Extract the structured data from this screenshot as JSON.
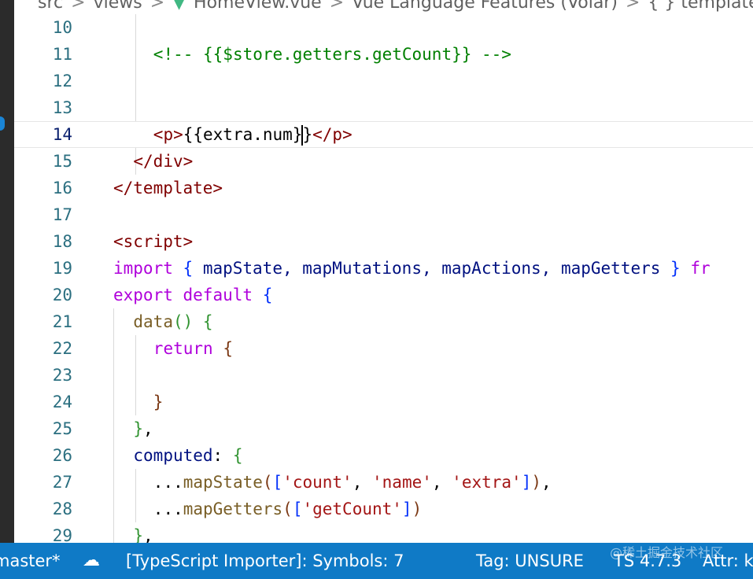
{
  "breadcrumb": {
    "items": [
      "src",
      "views",
      "HomeView.vue",
      "Vue Language Features (Volar)",
      "{ } template"
    ],
    "separator": ">",
    "vue_icon": "vue-logo-icon"
  },
  "editor": {
    "cursor_line": 14,
    "lines": [
      {
        "n": "10",
        "tokens": []
      },
      {
        "n": "11",
        "tokens": [
          {
            "t": "<!-- {{$store.getters.getCount}} -->",
            "c": "cmt"
          }
        ]
      },
      {
        "n": "12",
        "tokens": []
      },
      {
        "n": "13",
        "tokens": []
      },
      {
        "n": "14",
        "tokens": [
          {
            "t": "<p>",
            "c": "tag"
          },
          {
            "t": "{{extra.num}}",
            "c": ""
          },
          {
            "t": "</p>",
            "c": "tag"
          }
        ]
      },
      {
        "n": "15",
        "tokens": [
          {
            "t": "</div>",
            "c": "tag"
          }
        ]
      },
      {
        "n": "16",
        "tokens": [
          {
            "t": "</template>",
            "c": "tag"
          }
        ]
      },
      {
        "n": "17",
        "tokens": []
      },
      {
        "n": "18",
        "tokens": [
          {
            "t": "<script>",
            "c": "tag"
          }
        ]
      },
      {
        "n": "19",
        "tokens": [
          {
            "t": "import",
            "c": "kw"
          },
          {
            "t": " ",
            "c": ""
          },
          {
            "t": "{",
            "c": "br1"
          },
          {
            "t": " mapState, mapMutations, mapActions, mapGetters ",
            "c": "var"
          },
          {
            "t": "}",
            "c": "br1"
          },
          {
            "t": " fr",
            "c": "kw"
          }
        ]
      },
      {
        "n": "20",
        "tokens": [
          {
            "t": "export",
            "c": "kw"
          },
          {
            "t": " ",
            "c": ""
          },
          {
            "t": "default",
            "c": "kw"
          },
          {
            "t": " ",
            "c": ""
          },
          {
            "t": "{",
            "c": "br1"
          }
        ]
      },
      {
        "n": "21",
        "tokens": [
          {
            "t": "data",
            "c": "fn"
          },
          {
            "t": "()",
            "c": "br2"
          },
          {
            "t": " ",
            "c": ""
          },
          {
            "t": "{",
            "c": "br2"
          }
        ]
      },
      {
        "n": "22",
        "tokens": [
          {
            "t": "return",
            "c": "kw"
          },
          {
            "t": " ",
            "c": ""
          },
          {
            "t": "{",
            "c": "br3"
          }
        ]
      },
      {
        "n": "23",
        "tokens": []
      },
      {
        "n": "24",
        "tokens": [
          {
            "t": "}",
            "c": "br3"
          }
        ]
      },
      {
        "n": "25",
        "tokens": [
          {
            "t": "}",
            "c": "br2"
          },
          {
            "t": ",",
            "c": ""
          }
        ]
      },
      {
        "n": "26",
        "tokens": [
          {
            "t": "computed",
            "c": "var"
          },
          {
            "t": ": ",
            "c": ""
          },
          {
            "t": "{",
            "c": "br2"
          }
        ]
      },
      {
        "n": "27",
        "tokens": [
          {
            "t": "...",
            "c": ""
          },
          {
            "t": "mapState",
            "c": "fn"
          },
          {
            "t": "(",
            "c": "br3"
          },
          {
            "t": "[",
            "c": "br1"
          },
          {
            "t": "'count'",
            "c": "str"
          },
          {
            "t": ", ",
            "c": ""
          },
          {
            "t": "'name'",
            "c": "str"
          },
          {
            "t": ", ",
            "c": ""
          },
          {
            "t": "'extra'",
            "c": "str"
          },
          {
            "t": "]",
            "c": "br1"
          },
          {
            "t": ")",
            "c": "br3"
          },
          {
            "t": ",",
            "c": ""
          }
        ]
      },
      {
        "n": "28",
        "tokens": [
          {
            "t": "...",
            "c": ""
          },
          {
            "t": "mapGetters",
            "c": "fn"
          },
          {
            "t": "(",
            "c": "br3"
          },
          {
            "t": "[",
            "c": "br1"
          },
          {
            "t": "'getCount'",
            "c": "str"
          },
          {
            "t": "]",
            "c": "br1"
          },
          {
            "t": ")",
            "c": "br3"
          }
        ]
      },
      {
        "n": "29",
        "tokens": [
          {
            "t": "}",
            "c": "br2"
          },
          {
            "t": ",",
            "c": ""
          }
        ]
      }
    ]
  },
  "statusbar": {
    "branch": "master*",
    "sync_icon": "cloud-sync-icon",
    "importer": "[TypeScript Importer]: Symbols: 7",
    "tag": "Tag: UNSURE",
    "ts_version": "TS 4.7.3",
    "attr": "Attr: k"
  },
  "watermark": "@稀土掘金技术社区",
  "colors": {
    "statusbar": "#0f7ac6",
    "tag": "#800000",
    "comment": "#008000",
    "keyword": "#af00db"
  }
}
